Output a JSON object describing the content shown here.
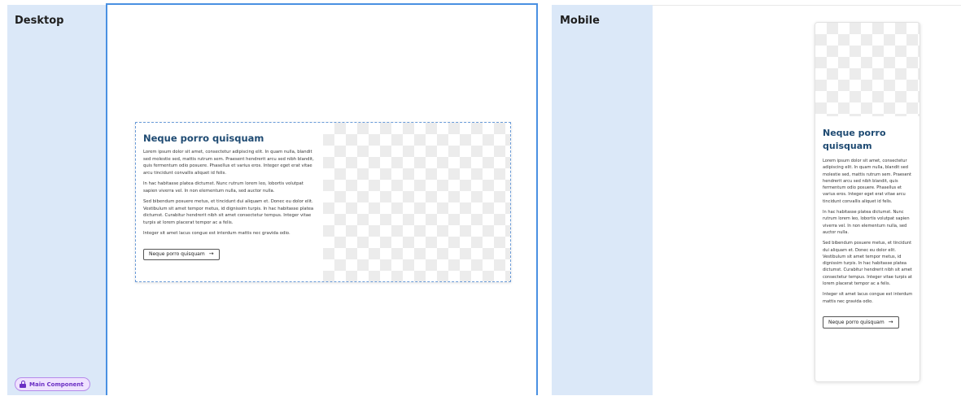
{
  "frames": {
    "desktop_label": "Desktop",
    "mobile_label": "Mobile"
  },
  "badge": {
    "label": "Main Component",
    "icon": "lock-icon"
  },
  "card": {
    "title": "Neque porro quisquam",
    "paragraphs": [
      "Lorem ipsum dolor sit amet, consectetur adipiscing elit. In quam nulla, blandit sed molestie sed, mattis rutrum sem. Praesent hendrerit arcu sed nibh blandit, quis fermentum odio posuere. Phasellus et varius eros. Integer eget erat vitae arcu tincidunt convallis aliquet id felis.",
      "In hac habitasse platea dictumst. Nunc rutrum lorem leo, lobortis volutpat sapien viverra vel. In non elementum nulla, sed auctor nulla.",
      "Sed bibendum posuere metus, et tincidunt dui aliquam et. Donec eu dolor elit. Vestibulum sit amet tempor metus, id dignissim turpis. In hac habitasse platea dictumst. Curabitur hendrerit nibh sit amet consectetur tempus. Integer vitae turpis at lorem placerat tempor ac a felis.",
      "Integer sit amet lacus congue est interdum mattis nec gravida odio."
    ],
    "button_label": "Neque porro quisquam",
    "button_icon": "arrow-right-icon"
  },
  "colors": {
    "sidebar": "#dbe8f8",
    "selection": "#4a90e2",
    "title": "#1e4a72",
    "badge": "#6b2fc4"
  }
}
